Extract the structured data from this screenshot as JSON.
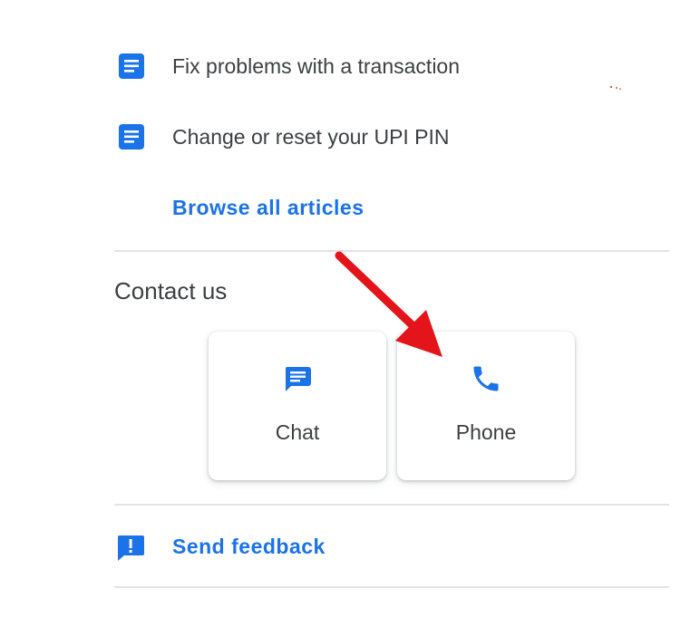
{
  "articles": [
    {
      "label": "Fix problems with a transaction",
      "icon": "article-icon"
    },
    {
      "label": "Change or reset your UPI PIN",
      "icon": "article-icon"
    }
  ],
  "browse_all_label": "Browse all articles",
  "contact": {
    "title": "Contact us",
    "options": [
      {
        "label": "Chat",
        "icon": "chat-icon"
      },
      {
        "label": "Phone",
        "icon": "phone-icon"
      }
    ]
  },
  "feedback": {
    "label": "Send feedback",
    "icon": "feedback-icon"
  },
  "colors": {
    "accent": "#1a73e8",
    "text": "#3c4043",
    "divider": "#e3e3e3",
    "annotation": "#e3151a"
  }
}
